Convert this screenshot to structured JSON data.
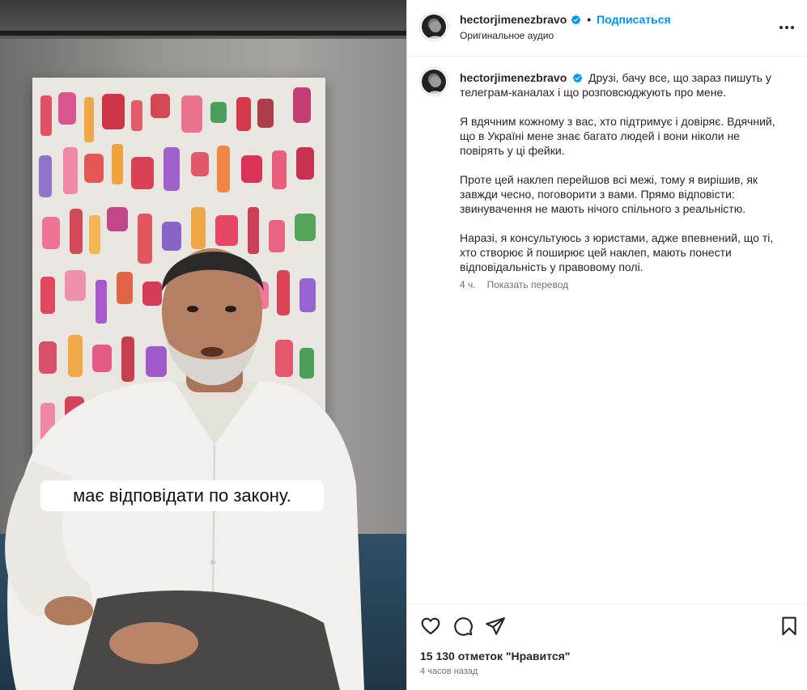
{
  "media": {
    "subtitle": "має відповідати по закону."
  },
  "header": {
    "username": "hectorjimenezbravo",
    "separator": "•",
    "follow_label": "Подписаться",
    "audio": "Оригинальное аудио",
    "more_icon": "more-horizontal-icon"
  },
  "caption": {
    "username": "hectorjimenezbravo",
    "paragraphs": [
      "Друзі, бачу все, що зараз пишуть у телеграм-каналах і що розповсюджують про мене.",
      "Я вдячним кожному з вас, хто підтримує і довіряє. Вдячний, що в Україні мене знає багато людей і вони ніколи не повірять у ці фейки.",
      "Проте цей наклеп перейшов всі межі, тому я вирішив, як завжди чесно, поговорити з вами. Прямо відповісти: звинувачення не мають нічого спільного з реальністю.",
      "Наразі, я консультуюсь з юристами, адже впевнений, що ті, хто створює й поширює цей наклеп, мають понести відповідальність у правовому полі."
    ],
    "age": "4 ч.",
    "translate_label": "Показать перевод"
  },
  "footer": {
    "likes": "15 130 отметок \"Нравится\"",
    "timestamp": "4 часов назад"
  },
  "colors": {
    "accent": "#0095f6",
    "verified": "#0095f6",
    "text": "#262626",
    "muted": "#737373"
  }
}
